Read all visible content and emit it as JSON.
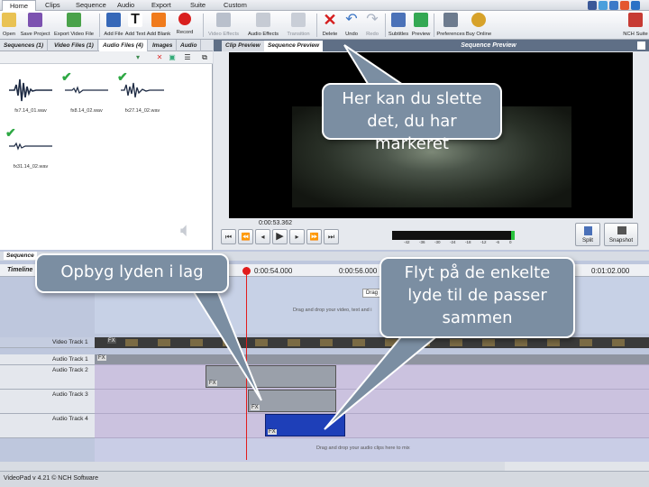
{
  "menu": {
    "tabs": [
      "Home",
      "Clips",
      "Sequence",
      "Audio",
      "Export",
      "Suite",
      "Custom"
    ],
    "active": "Home"
  },
  "toolbar": {
    "open": "Open",
    "save_project": "Save Project",
    "export_video": "Export Video File",
    "add_file": "Add File",
    "add_text": "Add Text",
    "add_blank": "Add Blank",
    "record": "Record",
    "video_effects": "Video Effects",
    "audio_effects": "Audio Effects",
    "transition": "Transition",
    "delete": "Delete",
    "undo": "Undo",
    "redo": "Redo",
    "subtitles": "Subtitles",
    "preview": "Preview",
    "preferences": "Preferences",
    "buy_online": "Buy Online",
    "nch_suite": "NCH Suite"
  },
  "bin": {
    "tabs": [
      "Sequences (1)",
      "Video Files (1)",
      "Audio Files (4)",
      "Images",
      "Audio"
    ],
    "active_tab": "Audio Files (4)",
    "clips": [
      {
        "name": "fx7.14_01.wav",
        "used": false
      },
      {
        "name": "fx8.14_02.wav",
        "used": true
      },
      {
        "name": "fx27.14_02.wav",
        "used": true
      },
      {
        "name": "fx31.14_02.wav",
        "used": true
      }
    ]
  },
  "preview": {
    "tabs": [
      "Clip Preview",
      "Sequence Preview"
    ],
    "active_tab": "Sequence Preview",
    "title": "Sequence Preview",
    "timecode": "0:00:53.362",
    "meter_labels": [
      "-42",
      "-36",
      "-30",
      "-24",
      "-18",
      "-12",
      "-6",
      "0"
    ],
    "split_label": "Split",
    "snapshot_label": "Snapshot"
  },
  "timeline": {
    "tab": "Sequence",
    "label": "Timeline",
    "ruler": [
      "0:00:54.000",
      "0:00:56.000",
      "0:01:02.000"
    ],
    "drop_video_btn": "Drag a",
    "drop_video_text": "Drag and drop your video, text and i",
    "tracks": [
      "Video Track 1",
      "Audio Track 1",
      "Audio Track 2",
      "Audio Track 3",
      "Audio Track 4"
    ],
    "fx": "FX",
    "drop_audio_text": "Drag and drop your audio clips here to mix"
  },
  "status": "VideoPad v 4.21 © NCH Software",
  "callouts": {
    "delete_hint": "Her kan du slette det, du har markeret",
    "layer_hint": "Opbyg lyden i lag",
    "move_hint": "Flyt på de enkelte lyde til de passer sammen"
  },
  "colors": {
    "callout_bg": "#7b8ea2",
    "audio_track_bg": "#cbc2df",
    "selected_clip": "#1e3fb8",
    "playhead": "#e11c1c"
  }
}
